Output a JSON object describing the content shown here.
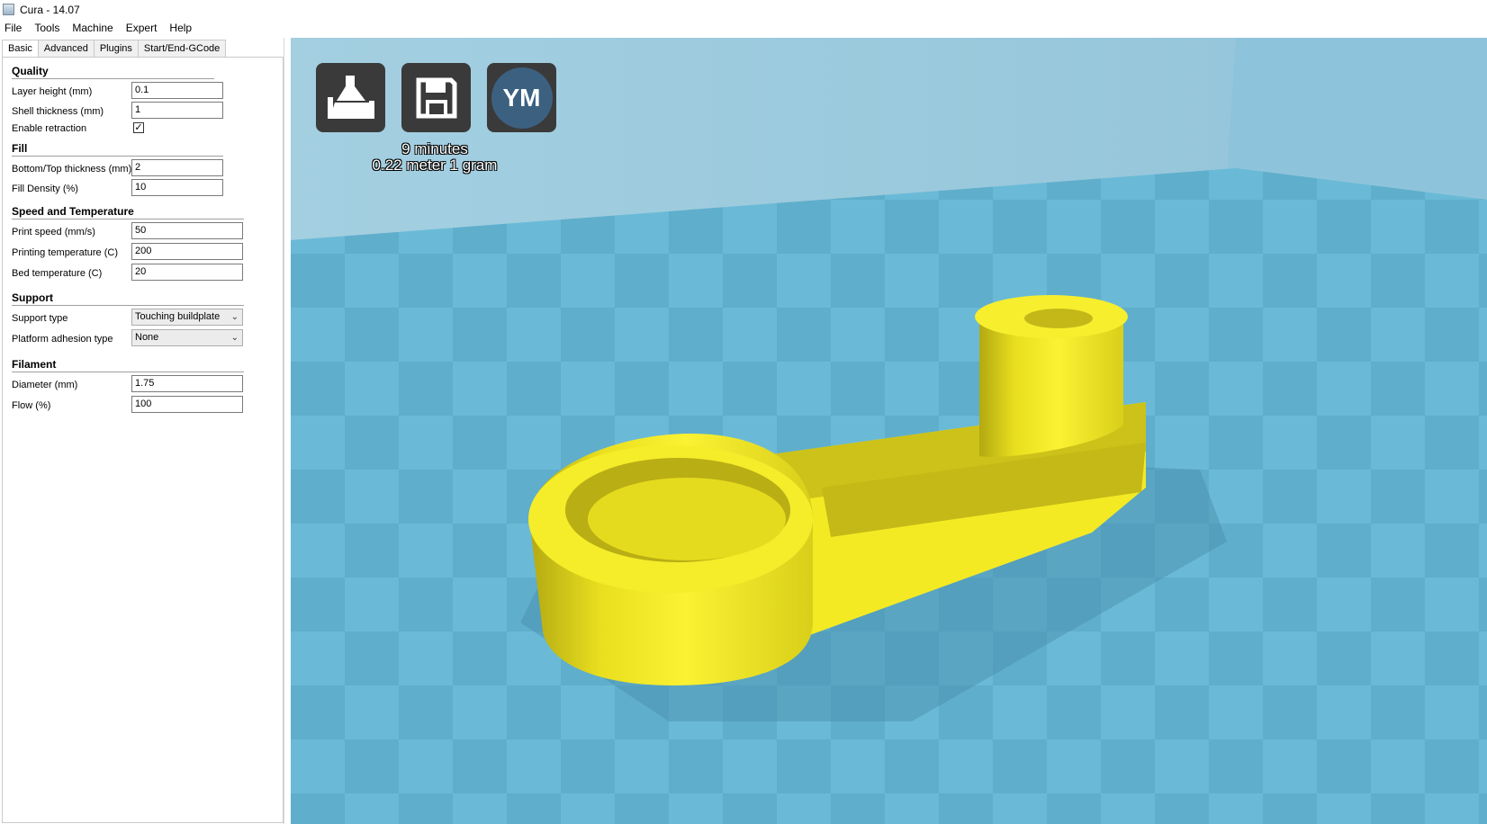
{
  "window": {
    "title": "Cura - 14.07"
  },
  "menu": [
    "File",
    "Tools",
    "Machine",
    "Expert",
    "Help"
  ],
  "tabs": [
    "Basic",
    "Advanced",
    "Plugins",
    "Start/End-GCode"
  ],
  "sections": {
    "quality": "Quality",
    "fill": "Fill",
    "speed": "Speed and Temperature",
    "support": "Support",
    "filament": "Filament"
  },
  "settings": {
    "layer_height": {
      "label": "Layer height (mm)",
      "value": "0.1"
    },
    "shell_thickness": {
      "label": "Shell thickness (mm)",
      "value": "1"
    },
    "enable_retraction": {
      "label": "Enable retraction",
      "checked": true
    },
    "bottom_top_thickness": {
      "label": "Bottom/Top thickness (mm)",
      "value": "2"
    },
    "fill_density": {
      "label": "Fill Density (%)",
      "value": "10"
    },
    "print_speed": {
      "label": "Print speed (mm/s)",
      "value": "50"
    },
    "printing_temperature": {
      "label": "Printing temperature (C)",
      "value": "200"
    },
    "bed_temperature": {
      "label": "Bed temperature (C)",
      "value": "20"
    },
    "support_type": {
      "label": "Support type",
      "value": "Touching buildplate"
    },
    "platform_adhesion": {
      "label": "Platform adhesion type",
      "value": "None"
    },
    "diameter": {
      "label": "Diameter (mm)",
      "value": "1.75"
    },
    "flow": {
      "label": "Flow (%)",
      "value": "100"
    }
  },
  "toolbar": {
    "ym_label": "YM"
  },
  "print_stats": {
    "time": "9 minutes",
    "material": "0.22 meter 1 gram"
  },
  "colors": {
    "model_yellow": "#f2e81c",
    "plate_light": "#6bbad7",
    "plate_dark": "#5aa7c4",
    "wall": "#9ccbde"
  }
}
